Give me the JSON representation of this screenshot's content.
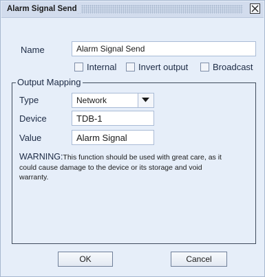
{
  "window": {
    "title": "Alarm Signal Send"
  },
  "form": {
    "name_label": "Name",
    "name_value": "Alarm Signal Send",
    "internal_label": "Internal",
    "invert_output_label": "Invert output",
    "broadcast_label": "Broadcast",
    "internal_checked": false,
    "invert_output_checked": false,
    "broadcast_checked": false
  },
  "output_mapping": {
    "legend": "Output Mapping",
    "type_label": "Type",
    "type_value": "Network",
    "device_label": "Device",
    "device_value": "TDB-1",
    "value_label": "Value",
    "value_value": "Alarm Signal",
    "warning_word": "WARNING:",
    "warning_text": "This function should be used with great care, as it could cause damage to the device or its storage and void warranty."
  },
  "buttons": {
    "ok_label": "OK",
    "cancel_label": "Cancel"
  },
  "icons": {
    "close": "close-icon",
    "dropdown": "chevron-down-icon"
  }
}
